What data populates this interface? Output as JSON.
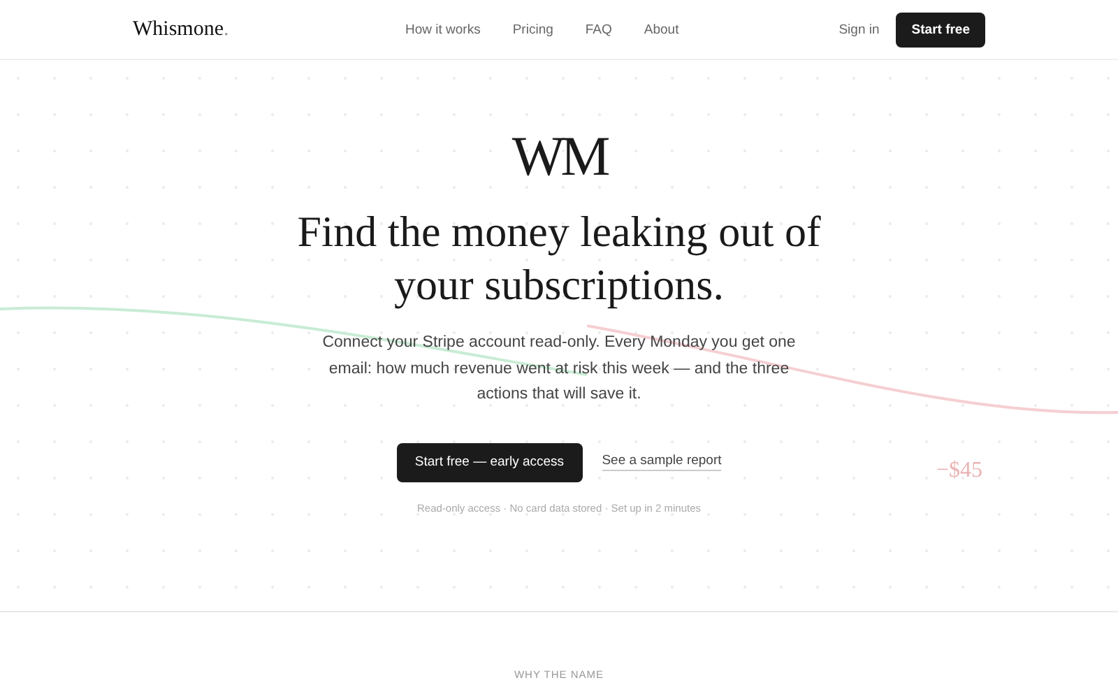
{
  "nav": {
    "brand": "Whismone",
    "brand_dot": ".",
    "links": [
      "How it works",
      "Pricing",
      "FAQ",
      "About"
    ],
    "sign_in": "Sign in",
    "cta": "Start free"
  },
  "hero": {
    "monogram": "WM",
    "title_lines": [
      "Find the money leaking out of",
      "your subscriptions."
    ],
    "description": "Connect your Stripe account read-only. Every Monday you get one email: how much revenue went at risk this week — and the three actions that will save it.",
    "primary_button": "Start free — early access",
    "secondary_link": "See a sample report",
    "note": "Read-only access · No card data stored · Set up in 2 minutes",
    "floating_amount": "−$45"
  },
  "next_section": {
    "eyebrow": "WHY THE NAME"
  }
}
